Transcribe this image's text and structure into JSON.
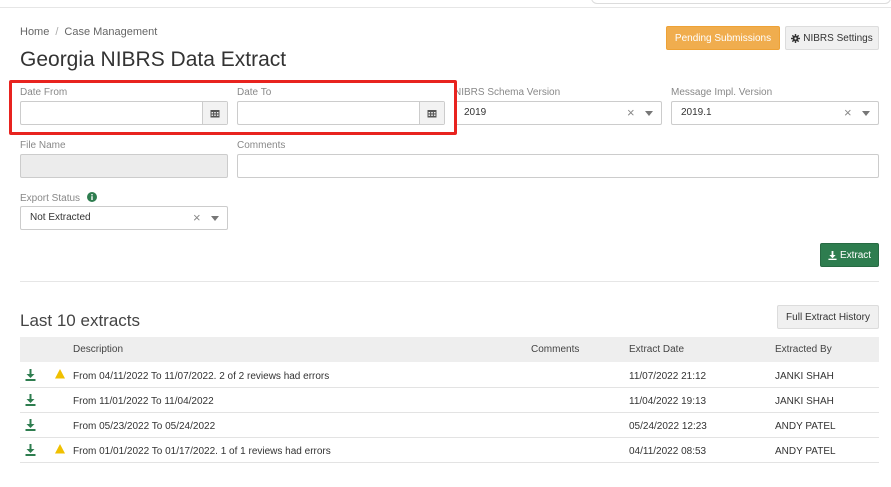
{
  "breadcrumb": {
    "home": "Home",
    "separator": "/",
    "current": "Case Management"
  },
  "page_title": "Georgia NIBRS Data Extract",
  "header_buttons": {
    "pending": "Pending Submissions",
    "settings": "NIBRS Settings"
  },
  "form": {
    "date_from": {
      "label": "Date From",
      "value": ""
    },
    "date_to": {
      "label": "Date To",
      "value": ""
    },
    "schema_version": {
      "label": "NIBRS Schema Version",
      "value": "2019"
    },
    "message_impl_version": {
      "label": "Message Impl. Version",
      "value": "2019.1"
    },
    "file_name": {
      "label": "File Name",
      "value": ""
    },
    "comments": {
      "label": "Comments",
      "value": ""
    },
    "export_status": {
      "label": "Export Status",
      "value": "Not Extracted"
    },
    "clear_symbol": "×"
  },
  "extract_button": "Extract",
  "extracts": {
    "title": "Last 10 extracts",
    "history_button": "Full Extract History",
    "columns": {
      "description": "Description",
      "comments": "Comments",
      "extract_date": "Extract Date",
      "extracted_by": "Extracted By"
    },
    "rows": [
      {
        "warning": true,
        "description": "From 04/11/2022 To 11/07/2022. 2 of 2 reviews had errors",
        "comments": "",
        "extract_date": "11/07/2022 21:12",
        "extracted_by": "JANKI SHAH"
      },
      {
        "warning": false,
        "description": "From 11/01/2022 To 11/04/2022",
        "comments": "",
        "extract_date": "11/04/2022 19:13",
        "extracted_by": "JANKI SHAH"
      },
      {
        "warning": false,
        "description": "From 05/23/2022 To 05/24/2022",
        "comments": "",
        "extract_date": "05/24/2022 12:23",
        "extracted_by": "ANDY PATEL"
      },
      {
        "warning": true,
        "description": "From 01/01/2022 To 01/17/2022. 1 of 1 reviews had errors",
        "comments": "",
        "extract_date": "04/11/2022 08:53",
        "extracted_by": "ANDY PATEL"
      }
    ]
  },
  "colors": {
    "accent_orange": "#f0ad4e",
    "extract_green": "#2e7d4f",
    "highlight_red": "#e8231f",
    "warning_yellow": "#f0c000"
  },
  "icons": {
    "calendar": "calendar-icon",
    "gear": "gear-icon",
    "info": "info-icon",
    "download": "download-icon",
    "warning": "warning-icon"
  }
}
